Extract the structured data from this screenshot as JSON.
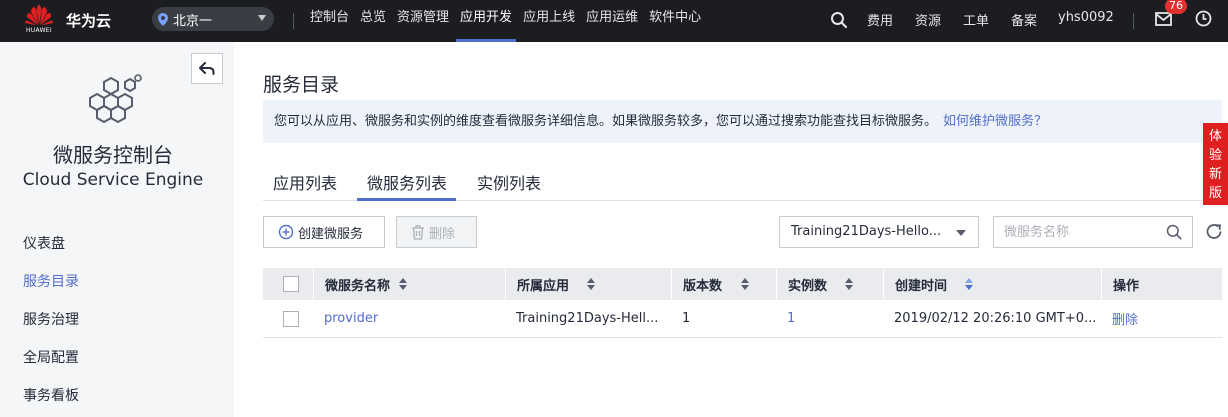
{
  "topbar": {
    "logo_text": "HUAWEI",
    "brand": "华为云",
    "region": "北京一",
    "nav": [
      "控制台",
      "总览",
      "资源管理",
      "应用开发",
      "应用上线",
      "应用运维",
      "软件中心"
    ],
    "active_nav": "应用开发",
    "right": {
      "fees": "费用",
      "resources": "资源",
      "tickets": "工单",
      "icp": "备案",
      "user": "yhs0092"
    },
    "message_count": "76"
  },
  "sidebar": {
    "title": "微服务控制台",
    "subtitle": "Cloud Service Engine",
    "items": [
      {
        "label": "仪表盘"
      },
      {
        "label": "服务目录"
      },
      {
        "label": "服务治理"
      },
      {
        "label": "全局配置"
      },
      {
        "label": "事务看板"
      }
    ],
    "active": "服务目录"
  },
  "main": {
    "title": "服务目录",
    "info": "您可以从应用、微服务和实例的维度查看微服务详细信息。如果微服务较多，您可以通过搜索功能查找目标微服务。",
    "info_link": "如何维护微服务？",
    "tabs": [
      "应用列表",
      "微服务列表",
      "实例列表"
    ],
    "active_tab": "微服务列表",
    "create_label": "创建微服务",
    "delete_label": "删除",
    "app_select_value": "Training21Days-Hello...",
    "search_placeholder": "微服务名称"
  },
  "table": {
    "columns": [
      "微服务名称",
      "所属应用",
      "版本数",
      "实例数",
      "创建时间",
      "操作"
    ],
    "rows": [
      {
        "name": "provider",
        "app": "Training21Days-Hell...",
        "versions": "1",
        "instances": "1",
        "created": "2019/02/12 20:26:10 GMT+0...",
        "action": "删除"
      }
    ]
  },
  "float": {
    "trial": "体验新版"
  },
  "colors": {
    "accent": "#526ecc",
    "topbar": "#1c1d21",
    "danger": "#e02020"
  }
}
